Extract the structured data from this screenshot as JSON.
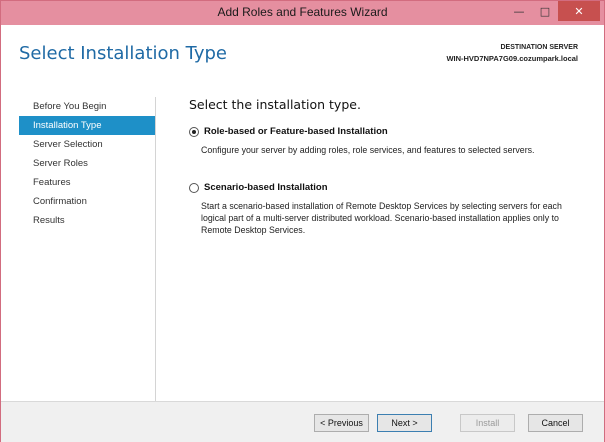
{
  "window": {
    "title": "Add Roles and Features Wizard",
    "controls": {
      "minimize": "—",
      "maximize": "□",
      "close": "✕"
    }
  },
  "header": {
    "page_title": "Select Installation Type",
    "destination_label": "DESTINATION SERVER",
    "destination_value": "WIN-HVD7NPA7G09.cozumpark.local"
  },
  "sidebar": {
    "items": [
      {
        "label": "Before You Begin",
        "active": false
      },
      {
        "label": "Installation Type",
        "active": true
      },
      {
        "label": "Server Selection",
        "active": false
      },
      {
        "label": "Server Roles",
        "active": false
      },
      {
        "label": "Features",
        "active": false
      },
      {
        "label": "Confirmation",
        "active": false
      },
      {
        "label": "Results",
        "active": false
      }
    ]
  },
  "content": {
    "heading": "Select the installation type.",
    "options": [
      {
        "label": "Role-based or Feature-based Installation",
        "selected": true,
        "description": "Configure your server by adding roles, role services, and features to selected servers."
      },
      {
        "label": "Scenario-based Installation",
        "selected": false,
        "description": "Start a scenario-based installation of Remote Desktop Services by selecting servers for each logical part of a multi-server distributed workload. Scenario-based installation applies only to Remote Desktop Services."
      }
    ]
  },
  "footer": {
    "previous": "< Previous",
    "next": "Next >",
    "install": "Install",
    "cancel": "Cancel"
  },
  "colors": {
    "titlebar": "#e58fa0",
    "accent": "#1e90c8",
    "title_text": "#1f6aa5"
  }
}
